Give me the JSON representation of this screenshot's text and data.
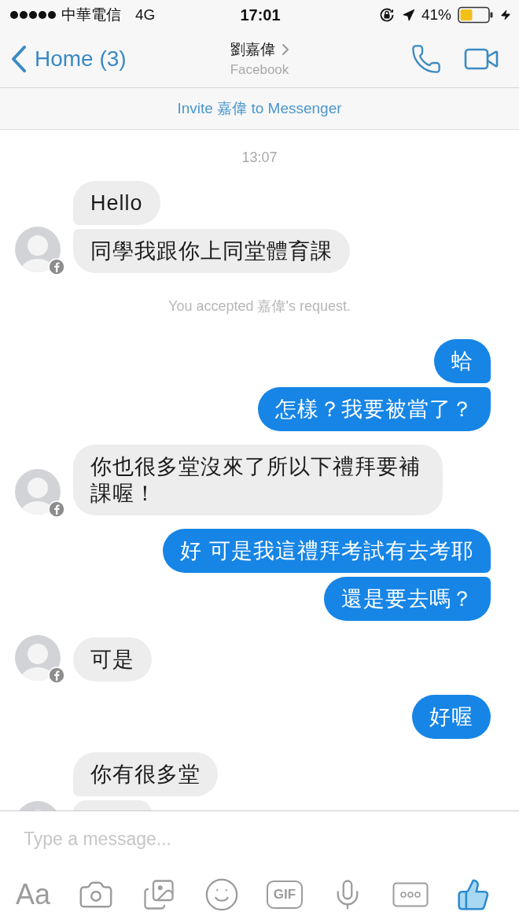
{
  "status_bar": {
    "carrier": "中華電信",
    "network": "4G",
    "time": "17:01",
    "battery": "41%"
  },
  "header": {
    "back_label": "Home (3)",
    "title": "劉嘉偉",
    "subtitle": "Facebook"
  },
  "invite_banner": {
    "text": "Invite 嘉偉 to Messenger"
  },
  "thread": [
    {
      "kind": "timestamp",
      "text": "13:07"
    },
    {
      "kind": "incoming",
      "continues_below": false,
      "bubbles": [
        "Hello",
        "同學我跟你上同堂體育課"
      ]
    },
    {
      "kind": "notice",
      "text": "You accepted 嘉偉's request."
    },
    {
      "kind": "outgoing",
      "continues_below": false,
      "bubbles": [
        "蛤",
        "怎樣？我要被當了？"
      ]
    },
    {
      "kind": "incoming",
      "continues_below": false,
      "bubbles": [
        "你也很多堂沒來了所以下禮拜要補課喔！"
      ]
    },
    {
      "kind": "outgoing",
      "continues_below": false,
      "bubbles": [
        "好 可是我這禮拜考試有去考耶",
        "還是要去嗎？"
      ]
    },
    {
      "kind": "incoming",
      "continues_below": false,
      "bubbles": [
        "可是"
      ]
    },
    {
      "kind": "outgoing",
      "continues_below": false,
      "bubbles": [
        "好喔"
      ]
    },
    {
      "kind": "incoming",
      "continues_below": true,
      "bubbles": [
        "你有很多堂"
      ]
    }
  ],
  "composer": {
    "placeholder": "Type a message...",
    "text_button": "Aa",
    "gif_button": "GIF"
  }
}
